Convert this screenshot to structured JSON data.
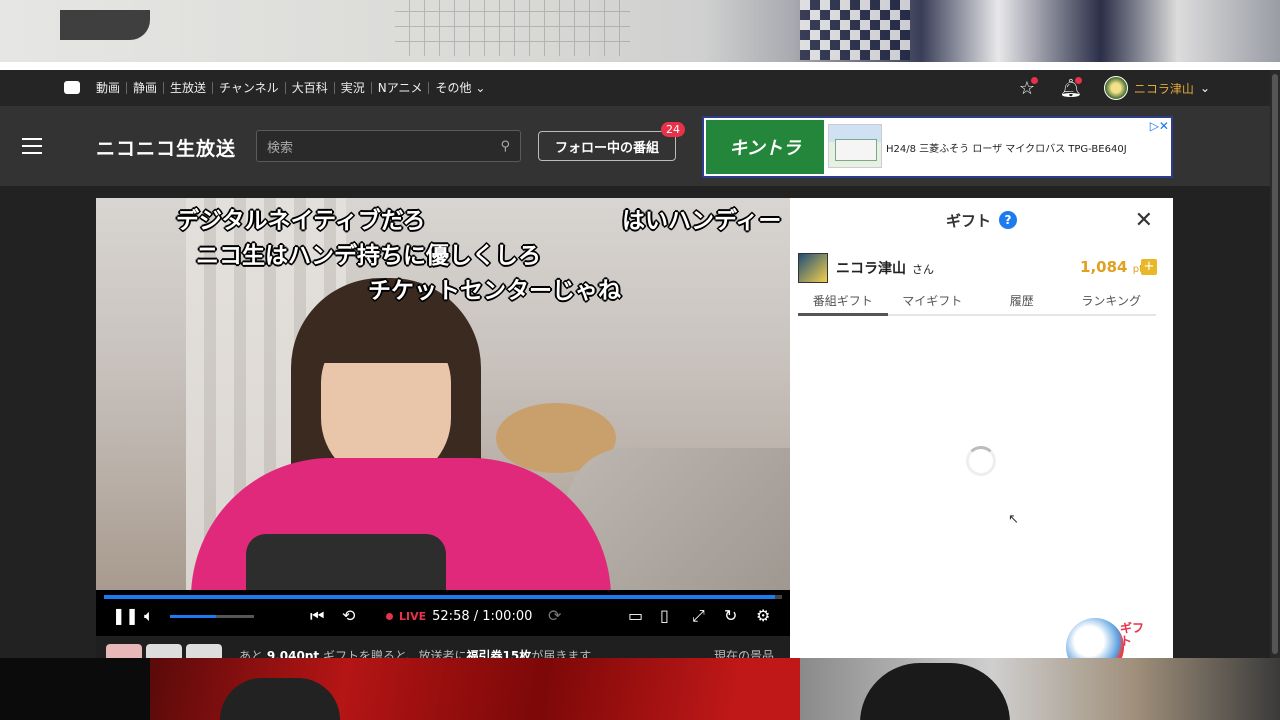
{
  "nav": {
    "links": [
      "動画",
      "静画",
      "生放送",
      "チャンネル",
      "大百科",
      "実況",
      "Nアニメ",
      "その他"
    ],
    "user_name": "ニコラ津山"
  },
  "header": {
    "logo": "ニコニコ生放送",
    "search_placeholder": "検索",
    "follow_label": "フォロー中の番組",
    "follow_count": "24"
  },
  "ad": {
    "brand": "キントラ",
    "text": "H24/8 三菱ふそう ローザ マイクロバス TPG-BE640J"
  },
  "comments": [
    {
      "text": "デジタルネイティブだろ"
    },
    {
      "text": "はいハンディー"
    },
    {
      "text": "ニコ生はハンデ持ちに優しくしろ"
    },
    {
      "text": "チケットセンターじゃね"
    }
  ],
  "player": {
    "live_label": "LIVE",
    "time": "52:58 / 1:00:00",
    "progress": 0.99,
    "volume": 0.55
  },
  "below": {
    "text_prefix": "あと",
    "points": "9,040pt",
    "text_mid": "ギフトを贈ると、放送者に",
    "reward": "福引券15枚",
    "text_suffix": "が届きます",
    "current_label": "現在の景品"
  },
  "gift": {
    "title": "ギフト",
    "help": "?",
    "user_name": "ニコラ津山",
    "honorific": "さん",
    "points": "1,084",
    "points_unit": "pt",
    "tabs": [
      "番組ギフト",
      "マイギフト",
      "履歴",
      "ランキング"
    ],
    "active_tab": 0
  },
  "colors": {
    "accent": "#1d7bf0",
    "live": "#e8324a",
    "points": "#e0a020"
  }
}
